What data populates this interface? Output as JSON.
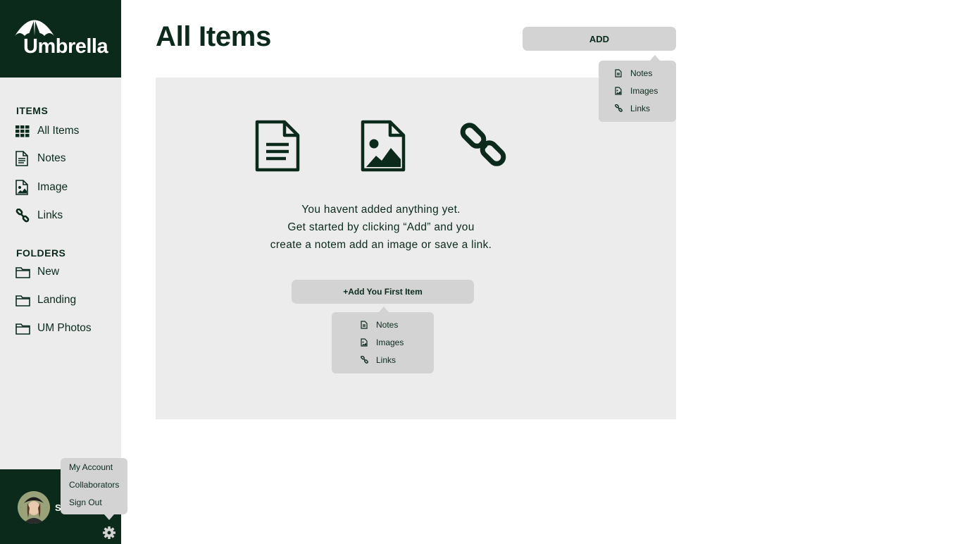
{
  "brand": {
    "name": "Umbrella",
    "logo_icon": "umbrella-icon"
  },
  "sidebar": {
    "items_title": "ITEMS",
    "items": [
      {
        "label": "All Items",
        "icon": "grid-icon"
      },
      {
        "label": "Notes",
        "icon": "document-icon"
      },
      {
        "label": "Image",
        "icon": "image-icon"
      },
      {
        "label": "Links",
        "icon": "link-icon"
      }
    ],
    "folders_title": "FOLDERS",
    "folders": [
      {
        "label": "New",
        "icon": "folder-icon"
      },
      {
        "label": "Landing",
        "icon": "folder-icon"
      },
      {
        "label": "UM Photos",
        "icon": "folder-icon"
      }
    ]
  },
  "user": {
    "initial": "S",
    "menu": [
      "My Account",
      "Collaborators",
      "Sign Out"
    ],
    "settings_icon": "gear-icon"
  },
  "main": {
    "title": "All Items",
    "add_label": "ADD",
    "add_menu": [
      "Notes",
      "Images",
      "Links"
    ],
    "empty": {
      "line1": "You havent added anything yet.",
      "line2": "Get started by clicking “Add” and you",
      "line3": "create a notem add an image or save a link.",
      "cta_label": "+Add You First Item",
      "cta_menu": [
        "Notes",
        "Images",
        "Links"
      ]
    }
  },
  "colors": {
    "brand_dark": "#0b2a1c",
    "sidebar_bg": "#ececec",
    "panel_bg": "#ececec",
    "button_bg": "#d3d3d3"
  }
}
